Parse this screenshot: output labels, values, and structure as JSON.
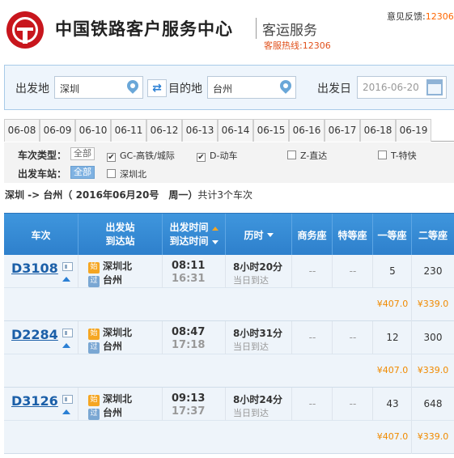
{
  "header": {
    "title": "中国铁路客户服务中心",
    "subtitle": "客运服务",
    "hotline": "客服热线:12306",
    "feedback_label": "意见反馈:",
    "feedback_value": "12306"
  },
  "search": {
    "from_label": "出发地",
    "from_value": "深圳",
    "to_label": "目的地",
    "to_value": "台州",
    "date_label": "出发日",
    "date_value": "2016-06-20",
    "swap_icon": "⇄"
  },
  "date_tabs": [
    "06-08",
    "06-09",
    "06-10",
    "06-11",
    "06-12",
    "06-13",
    "06-14",
    "06-15",
    "06-16",
    "06-17",
    "06-18",
    "06-19"
  ],
  "filters": {
    "type_label": "车次类型：",
    "type_all": "全部",
    "type_options": [
      {
        "label": "GC-高铁/城际",
        "checked": true
      },
      {
        "label": "D-动车",
        "checked": true
      },
      {
        "label": "Z-直达",
        "checked": false
      },
      {
        "label": "T-特快",
        "checked": false
      }
    ],
    "station_label": "出发车站：",
    "station_all": "全部",
    "station_option": "深圳北"
  },
  "summary": {
    "route": "深圳 -> 台州",
    "date": "（ 2016年06月20号　周一）",
    "count": "共计3个车次"
  },
  "table": {
    "headers": {
      "train": "车次",
      "station_top": "出发站",
      "station_bottom": "到达站",
      "time_top": "出发时间",
      "time_bottom": "到达时间",
      "duration": "历时",
      "business": "商务座",
      "premium": "特等座",
      "first": "一等座",
      "second": "二等座"
    },
    "badge_start": "始",
    "badge_via": "过",
    "rows": [
      {
        "train": "D3108",
        "from": "深圳北",
        "to": "台州",
        "depart": "08:11",
        "arrive": "16:31",
        "duration": "8小时20分",
        "arrival_day": "当日到达",
        "business": "--",
        "premium": "--",
        "first": "5",
        "second": "230",
        "first_price": "¥407.0",
        "second_price": "¥339.0"
      },
      {
        "train": "D2284",
        "from": "深圳北",
        "to": "台州",
        "depart": "08:47",
        "arrive": "17:18",
        "duration": "8小时31分",
        "arrival_day": "当日到达",
        "business": "--",
        "premium": "--",
        "first": "12",
        "second": "300",
        "first_price": "¥407.0",
        "second_price": "¥339.0"
      },
      {
        "train": "D3126",
        "from": "深圳北",
        "to": "台州",
        "depart": "09:13",
        "arrive": "17:37",
        "duration": "8小时24分",
        "arrival_day": "当日到达",
        "business": "--",
        "premium": "--",
        "first": "43",
        "second": "648",
        "first_price": "¥407.0",
        "second_price": "¥339.0"
      }
    ]
  },
  "colors": {
    "brand_red": "#c8161d",
    "header_blue": "#2e80cc",
    "price_orange": "#f08a00",
    "train_link": "#1b5fa8"
  }
}
